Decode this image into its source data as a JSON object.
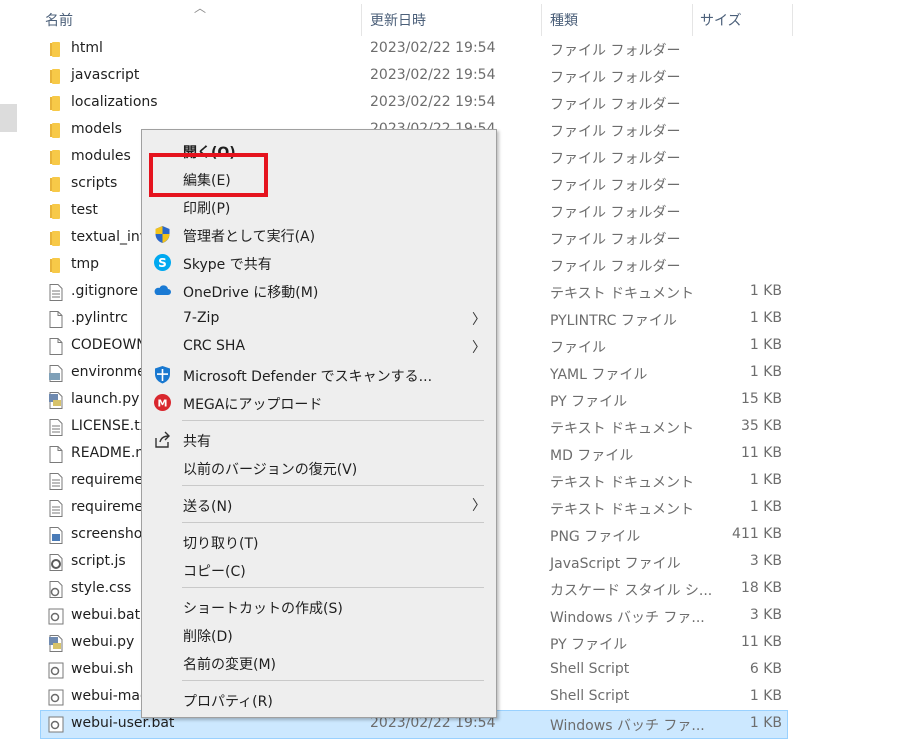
{
  "header": {
    "name": "名前",
    "date": "更新日時",
    "type": "種類",
    "size": "サイズ"
  },
  "files": [
    {
      "name": "html",
      "date": "2023/02/22 19:54",
      "type": "ファイル フォルダー",
      "size": "",
      "icon": "folder-icon"
    },
    {
      "name": "javascript",
      "date": "2023/02/22 19:54",
      "type": "ファイル フォルダー",
      "size": "",
      "icon": "folder-icon"
    },
    {
      "name": "localizations",
      "date": "2023/02/22 19:54",
      "type": "ファイル フォルダー",
      "size": "",
      "icon": "folder-icon"
    },
    {
      "name": "models",
      "date": "2023/02/22 19:54",
      "type": "ファイル フォルダー",
      "size": "",
      "icon": "folder-icon"
    },
    {
      "name": "modules",
      "date": "",
      "type": "ファイル フォルダー",
      "size": "",
      "icon": "folder-icon"
    },
    {
      "name": "scripts",
      "date": "",
      "type": "ファイル フォルダー",
      "size": "",
      "icon": "folder-icon"
    },
    {
      "name": "test",
      "date": "",
      "type": "ファイル フォルダー",
      "size": "",
      "icon": "folder-icon"
    },
    {
      "name": "textual_inv",
      "date": "",
      "type": "ファイル フォルダー",
      "size": "",
      "icon": "folder-icon"
    },
    {
      "name": "tmp",
      "date": "",
      "type": "ファイル フォルダー",
      "size": "",
      "icon": "folder-icon"
    },
    {
      "name": ".gitignore",
      "date": "",
      "type": "テキスト ドキュメント",
      "size": "1 KB",
      "icon": "text-file-icon"
    },
    {
      "name": ".pylintrc",
      "date": "",
      "type": "PYLINTRC ファイル",
      "size": "1 KB",
      "icon": "blank-file-icon"
    },
    {
      "name": "CODEOWN",
      "date": "",
      "type": "ファイル",
      "size": "1 KB",
      "icon": "blank-file-icon"
    },
    {
      "name": "environme",
      "date": "",
      "type": "YAML ファイル",
      "size": "1 KB",
      "icon": "yaml-file-icon"
    },
    {
      "name": "launch.py",
      "date": "",
      "type": "PY ファイル",
      "size": "15 KB",
      "icon": "python-file-icon"
    },
    {
      "name": "LICENSE.tx",
      "date": "",
      "type": "テキスト ドキュメント",
      "size": "35 KB",
      "icon": "text-file-icon"
    },
    {
      "name": "README.m",
      "date": "",
      "type": "MD ファイル",
      "size": "11 KB",
      "icon": "blank-file-icon"
    },
    {
      "name": "requireme",
      "date": "",
      "type": "テキスト ドキュメント",
      "size": "1 KB",
      "icon": "text-file-icon"
    },
    {
      "name": "requireme",
      "date": "",
      "type": "テキスト ドキュメント",
      "size": "1 KB",
      "icon": "text-file-icon"
    },
    {
      "name": "screenshot",
      "date": "",
      "type": "PNG ファイル",
      "size": "411 KB",
      "icon": "image-file-icon"
    },
    {
      "name": "script.js",
      "date": "",
      "type": "JavaScript ファイル",
      "size": "3 KB",
      "icon": "javascript-file-icon"
    },
    {
      "name": "style.css",
      "date": "",
      "type": "カスケード スタイル シ...",
      "size": "18 KB",
      "icon": "css-file-icon"
    },
    {
      "name": "webui.bat",
      "date": "",
      "type": "Windows バッチ ファ...",
      "size": "3 KB",
      "icon": "batch-file-icon"
    },
    {
      "name": "webui.py",
      "date": "",
      "type": "PY ファイル",
      "size": "11 KB",
      "icon": "python-file-icon"
    },
    {
      "name": "webui.sh",
      "date": "",
      "type": "Shell Script",
      "size": "6 KB",
      "icon": "shell-file-icon"
    },
    {
      "name": "webui-mac",
      "date": "",
      "type": "Shell Script",
      "size": "1 KB",
      "icon": "shell-file-icon"
    },
    {
      "name": "webui-user.bat",
      "date": "2023/02/22 19:54",
      "type": "Windows バッチ ファ...",
      "size": "1 KB",
      "icon": "batch-file-icon"
    }
  ],
  "context_menu": [
    {
      "label": "開く(O)",
      "icon": "",
      "bold": true
    },
    {
      "label": "編集(E)",
      "icon": ""
    },
    {
      "label": "印刷(P)",
      "icon": ""
    },
    {
      "label": "管理者として実行(A)",
      "icon": "uac-shield-icon"
    },
    {
      "label": "Skype で共有",
      "icon": "skype-icon"
    },
    {
      "label": "OneDrive に移動(M)",
      "icon": "onedrive-cloud-icon"
    },
    {
      "label": "7-Zip",
      "icon": "",
      "submenu": true
    },
    {
      "label": "CRC SHA",
      "icon": "",
      "submenu": true
    },
    {
      "label": "Microsoft Defender でスキャンする...",
      "icon": "defender-icon"
    },
    {
      "label": "MEGAにアップロード",
      "icon": "mega-icon",
      "sep_after": true
    },
    {
      "label": "共有",
      "icon": "share-icon"
    },
    {
      "label": "以前のバージョンの復元(V)",
      "icon": "",
      "sep_after": true
    },
    {
      "label": "送る(N)",
      "icon": "",
      "submenu": true,
      "sep_after": true
    },
    {
      "label": "切り取り(T)",
      "icon": ""
    },
    {
      "label": "コピー(C)",
      "icon": "",
      "sep_after": true
    },
    {
      "label": "ショートカットの作成(S)",
      "icon": ""
    },
    {
      "label": "削除(D)",
      "icon": ""
    },
    {
      "label": "名前の変更(M)",
      "icon": "",
      "sep_after": true
    },
    {
      "label": "プロパティ(R)",
      "icon": ""
    }
  ],
  "colors": {
    "selection": "#cce8ff",
    "highlight_box": "#e5131e",
    "folder": "#f7c948",
    "menu_bg": "#eeeeee"
  }
}
